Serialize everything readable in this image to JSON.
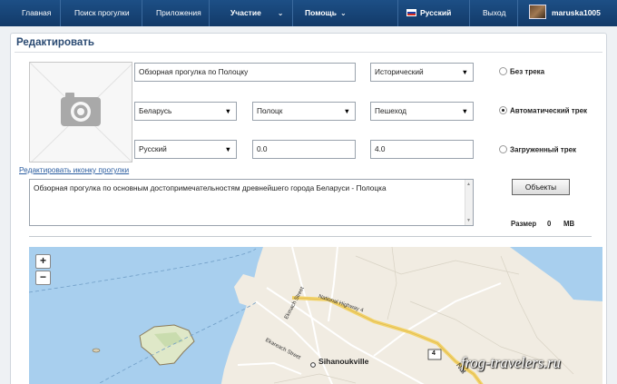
{
  "nav": {
    "items": [
      "Главная",
      "Поиск прогулки",
      "Приложения",
      "Участие",
      "Помощь"
    ],
    "language": "Русский",
    "logout": "Выход",
    "username": "maruska1005",
    "flag_colors": [
      "#ffffff",
      "#1c3fa8",
      "#d52b1e"
    ]
  },
  "panel": {
    "title": "Редактировать",
    "edit_icon_link": "Редактировать иконку прогулки"
  },
  "form": {
    "name": "Обзорная прогулка по Полоцку",
    "category": "Исторический",
    "country": "Беларусь",
    "city": "Полоцк",
    "transport": "Пешеход",
    "language": "Русский",
    "distance": "0.0",
    "duration": "4.0",
    "description": "Обзорная прогулка по основным достопримечательностям древнейшего города Беларуси - Полоцка"
  },
  "track": {
    "options": [
      "Без трека",
      "Автоматический трек",
      "Загруженный трек"
    ],
    "selected_index": 1
  },
  "objects_button": "Объекты",
  "size": {
    "label": "Размер",
    "value": "0",
    "unit": "MB"
  },
  "map": {
    "zoom_in": "+",
    "zoom_out": "−",
    "road_labels": [
      "National Highway 4",
      "Ekmach Street",
      "Ekareach Street",
      "Nat"
    ],
    "route_number": "4",
    "city": "Sihanoukville"
  },
  "watermark": "frog-travelers.ru",
  "icons": [
    "camera-icon",
    "chevron-down-icon",
    "flag-icon",
    "avatar"
  ]
}
